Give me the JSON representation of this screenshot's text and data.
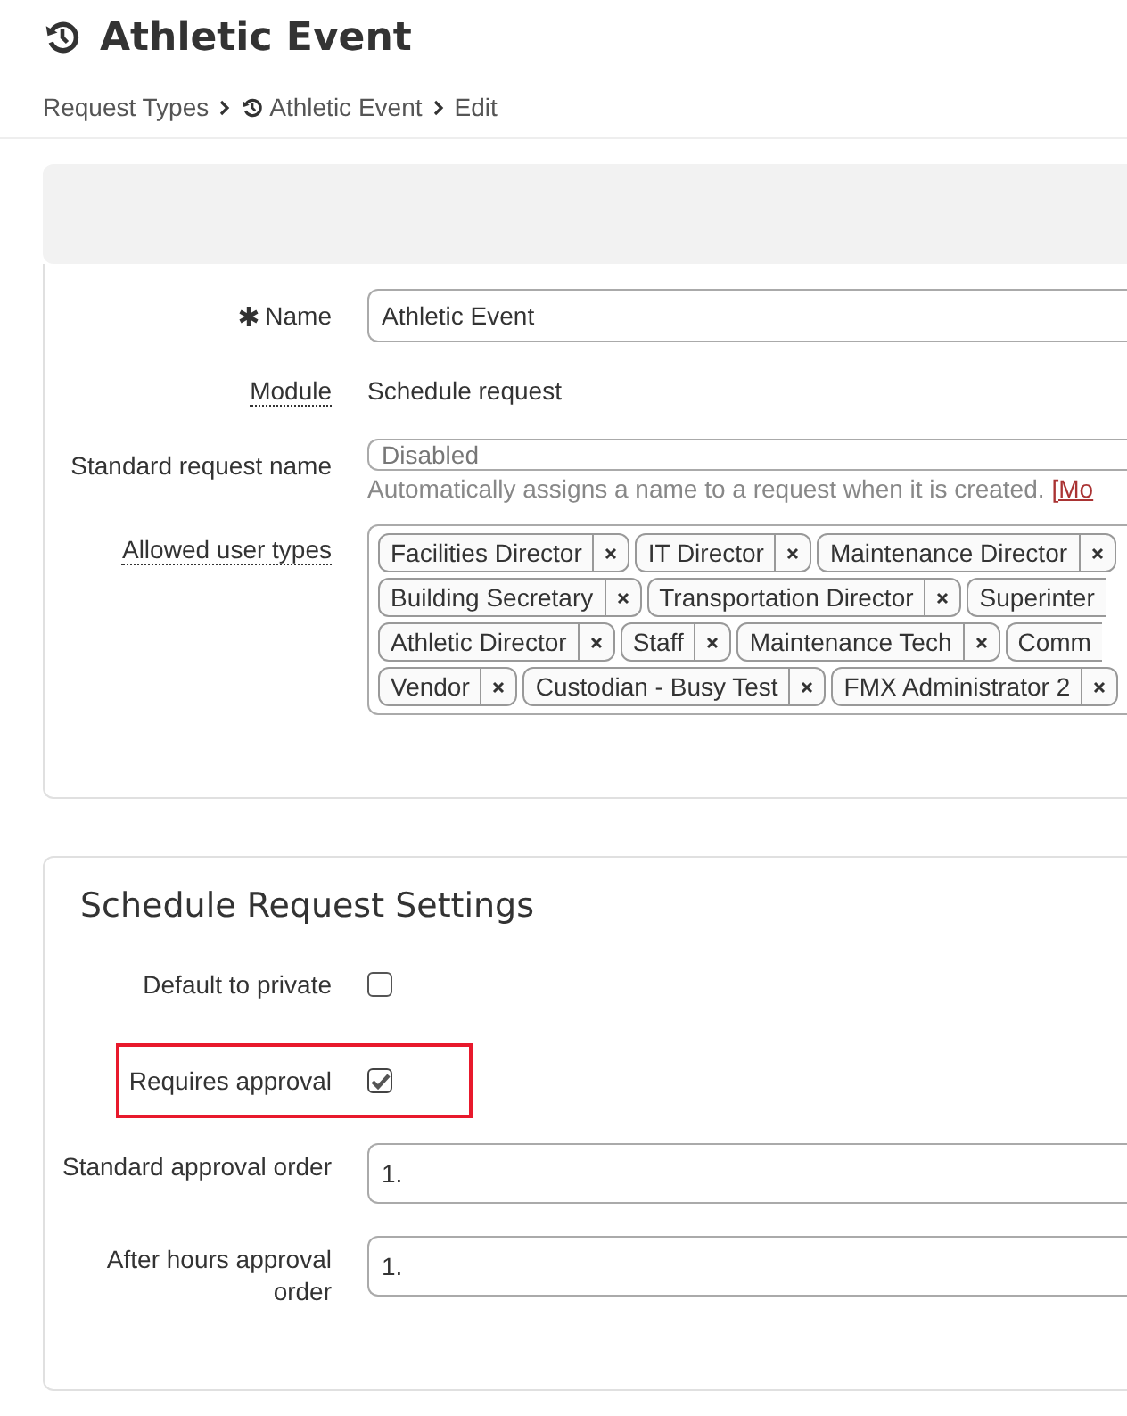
{
  "title": "Athletic Event",
  "breadcrumbs": [
    {
      "label": "Request Types",
      "icon": false
    },
    {
      "label": "Athletic Event",
      "icon": true
    },
    {
      "label": "Edit",
      "icon": false
    }
  ],
  "general": {
    "name": {
      "label": "Name",
      "required": true,
      "value": "Athletic Event"
    },
    "module": {
      "label": "Module",
      "value": "Schedule request"
    },
    "standard_name": {
      "label": "Standard request name",
      "placeholder": "Disabled",
      "help": "Automatically assigns a name to a request when it is created.",
      "help_link": "[Mo"
    },
    "user_types": {
      "label": "Allowed user types",
      "rows": [
        [
          {
            "text": "Facilities Director",
            "cut": false
          },
          {
            "text": "IT Director",
            "cut": false
          },
          {
            "text": "Maintenance Director",
            "cut": false
          }
        ],
        [
          {
            "text": "Building Secretary",
            "cut": false
          },
          {
            "text": "Transportation Director",
            "cut": false
          },
          {
            "text": "Superinter",
            "cut": true
          }
        ],
        [
          {
            "text": "Athletic Director",
            "cut": false
          },
          {
            "text": "Staff",
            "cut": false
          },
          {
            "text": "Maintenance Tech",
            "cut": false
          },
          {
            "text": "Comm",
            "cut": true
          }
        ],
        [
          {
            "text": "Vendor",
            "cut": false
          },
          {
            "text": "Custodian - Busy Test",
            "cut": false
          },
          {
            "text": "FMX Administrator 2",
            "cut": false
          }
        ]
      ]
    }
  },
  "schedule": {
    "title": "Schedule Request Settings",
    "checks": [
      {
        "label": "Default to private",
        "checked": false,
        "highlighted": false
      },
      {
        "label": "Requires approval",
        "checked": true,
        "highlighted": true
      }
    ],
    "orders": [
      {
        "label": "Standard approval order",
        "value": "1."
      },
      {
        "label": "After hours approval order",
        "value": "1."
      }
    ]
  }
}
